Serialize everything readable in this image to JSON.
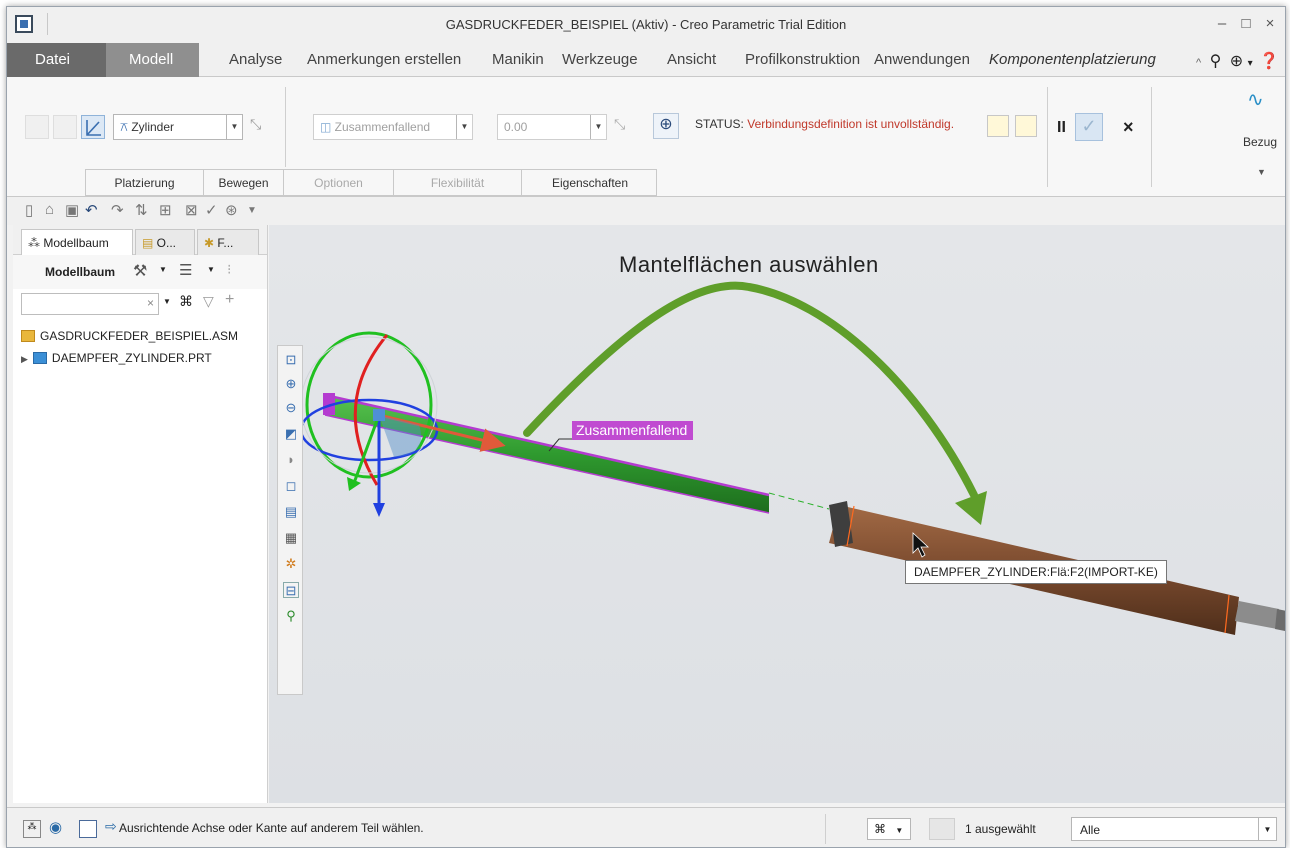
{
  "window": {
    "title": "GASDRUCKFEDER_BEISPIEL (Aktiv) - Creo Parametric Trial Edition",
    "controls": [
      "–",
      "□",
      "×"
    ]
  },
  "ribbon_tabs": [
    {
      "label": "Datei"
    },
    {
      "label": "Modell"
    },
    {
      "label": "Analyse"
    },
    {
      "label": "Anmerkungen erstellen"
    },
    {
      "label": "Manikin"
    },
    {
      "label": "Werkzeuge"
    },
    {
      "label": "Ansicht"
    },
    {
      "label": "Profilkonstruktion"
    },
    {
      "label": "Anwendungen"
    },
    {
      "label": "Komponentenplatzierung"
    }
  ],
  "ribbon": {
    "constraint_set": "Zylinder",
    "constraint_type": "Zusammenfallend",
    "offset_value": "0.00",
    "status_label": "STATUS:",
    "status_text": "Verbindungsdefinition ist unvollständig.",
    "bezug_label": "Bezug",
    "subtabs": [
      {
        "label": "Platzierung",
        "enabled": true
      },
      {
        "label": "Bewegen",
        "enabled": true
      },
      {
        "label": "Optionen",
        "enabled": false
      },
      {
        "label": "Flexibilität",
        "enabled": false
      },
      {
        "label": "Eigenschaften",
        "enabled": true
      }
    ]
  },
  "left_panel": {
    "tabs": [
      {
        "label": "Modellbaum"
      },
      {
        "label": "O..."
      },
      {
        "label": "F..."
      }
    ],
    "toolbar_title": "Modellbaum",
    "tree": [
      {
        "label": "GASDRUCKFEDER_BEISPIEL.ASM",
        "type": "assembly"
      },
      {
        "label": "DAEMPFER_ZYLINDER.PRT",
        "type": "part"
      }
    ]
  },
  "viewport": {
    "annotation": "Mantelflächen auswählen",
    "constraint_tag": "Zusammenfallend",
    "tooltip": "DAEMPFER_ZYLINDER:Flä:F2(IMPORT-KE)",
    "colors": {
      "background": "#e0e2e6",
      "rod": "#2f9a2f",
      "rod_edge": "#b43bd0",
      "cylinder": "#7a4a2e",
      "arrow": "#5f9e2a",
      "axis_x": "#e02020",
      "axis_y": "#20c020",
      "axis_z": "#2040e0"
    }
  },
  "statusbar": {
    "message": "Ausrichtende Achse oder Kante auf anderem Teil wählen.",
    "selection_count": "1 ausgewählt",
    "filter": "Alle"
  }
}
